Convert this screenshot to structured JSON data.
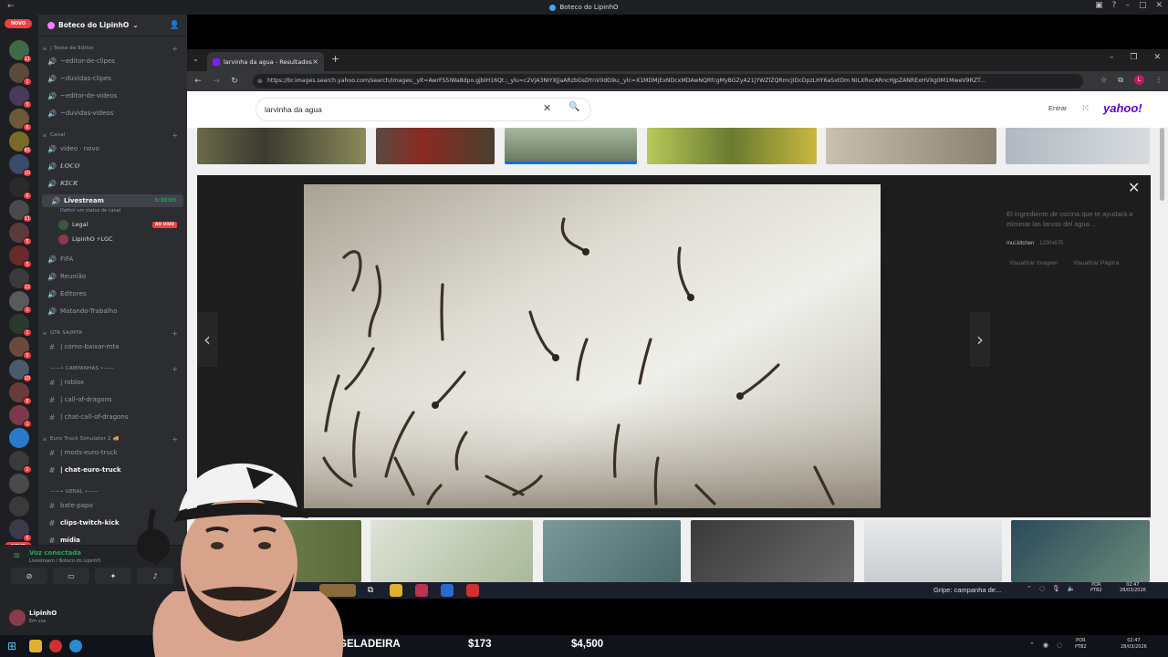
{
  "discord": {
    "window_title": "Boteco do LipinhO",
    "server_name": "Boteco do LipinhO",
    "novo_label": "NOVO",
    "server_badges": [
      "11",
      "1",
      "5",
      "6",
      "81",
      "10",
      "6",
      "11",
      "5",
      "5",
      "12",
      "1",
      "1",
      "5",
      "10",
      "8",
      "1",
      "1",
      "5",
      "18"
    ],
    "categories": {
      "editor": "| Teste de Editor",
      "canal": "Canal",
      "gta": "GTA SA/MTA",
      "campanhas": "——• CAMPANHAS •——",
      "euro": "Euro Truck Simulator 2 🚚",
      "geral": "——• GERAL •——"
    },
    "channels": {
      "editor_de_clipes": "~editor-de-clipes",
      "duvidas_clipes": "~duvidas-clipes",
      "editor_de_videos": "~editor-de-videos",
      "duvidas_videos": "~duvidas-videos",
      "video_novo": "video · novo",
      "loco": "𝙇𝙊𝘾𝙊",
      "kick": "𝙆𝙄𝘾𝙆",
      "livestream": "Livestream",
      "livestream_timer": "5:38:03",
      "livestream_status": "Definir um status de canal",
      "member_legal": "Legal",
      "member_legal_badge": "AO VIVO",
      "member_lipinho": "LipinhO ⚡LGC",
      "fifa": "FIFA",
      "reuniao": "Reunião",
      "editores": "Editores",
      "matando_trabalho": "Matando-Trabalho",
      "como_baixar_mta": "| como-baixar-mta",
      "roblox": "| roblox",
      "call_of_dragons": "| call-of-dragons",
      "chat_call_of_dragons": "| chat-call-of-dragons",
      "mods_euro_truck": "| mods-euro-truck",
      "chat_euro_truck": "| chat-euro-truck",
      "bate_papo": "bate-papo",
      "clips_twitch_kick": "clips-twitch-kick",
      "midia": "mídia"
    },
    "voice": {
      "status": "Voz conectada",
      "channel": "Livestream / Boteco do LipinhO"
    },
    "user": {
      "name": "LipinhO",
      "status": "Em voz"
    }
  },
  "browser": {
    "tab_title": "larvinha da agua - Resultados",
    "url": "https://br.images.search.yahoo.com/search/images;_ylt=AwrFS5IWa8dpo.gjbIH16Qt.;_ylu=c2VjA3NIYXJjaARzbGsDYnV0dG9u;_ylc=X1MDMjExNDcxMDAwNQRfcgMyBGZyA21jYWZlZQRmcjIDcDpzLHY6aSxtOm NiLXRvcARncHJpZANRExHVXg0M1MweV9RZT..."
  },
  "yahoo": {
    "search_value": "larvinha da agua",
    "signin": "Entrar",
    "logo": "yahoo!",
    "info_description": "El ingrediente de cocina que te ayudará a eliminar las larvas del agua ...",
    "info_source": "mui.kitchen",
    "info_size": "1200x675",
    "view_image": "Visualizar Imagem",
    "view_page": "Visualizar Página"
  },
  "inner_taskbar": {
    "news": "Gripe: campanha de...",
    "lang_top": "POR",
    "lang_bottom": "PTB2",
    "time": "02:47",
    "date": "28/03/2026"
  },
  "stream_overlay": {
    "stat_label": "GELADEIRA",
    "stat_value_1": "$173",
    "stat_value_2": "$4,500",
    "lang_top": "POR",
    "lang_bottom": "PTB2",
    "time": "02:47",
    "date": "28/03/2026"
  }
}
